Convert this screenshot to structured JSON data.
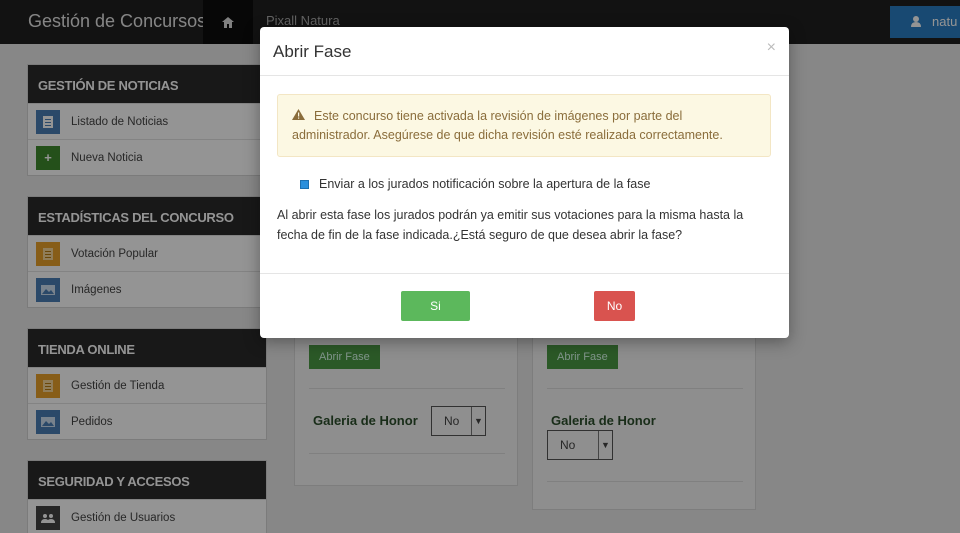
{
  "navbar": {
    "brand": "Gestión de Concursos",
    "home_icon": "home-icon",
    "link": "Pixall Natura",
    "user_label": "natu",
    "user_icon": "user-icon"
  },
  "sidebar": {
    "panels": [
      {
        "title": "GESTIÓN DE NOTICIAS",
        "items": [
          {
            "label": "Listado de Noticias",
            "icon": "document-icon"
          },
          {
            "label": "Nueva Noticia",
            "icon": "plus-icon"
          }
        ]
      },
      {
        "title": "ESTADÍSTICAS DEL CONCURSO",
        "items": [
          {
            "label": "Votación Popular",
            "icon": "list-icon"
          },
          {
            "label": "Imágenes",
            "icon": "image-icon"
          }
        ]
      },
      {
        "title": "TIENDA ONLINE",
        "items": [
          {
            "label": "Gestión de Tienda",
            "icon": "list-icon"
          },
          {
            "label": "Pedidos",
            "icon": "image-icon"
          }
        ]
      },
      {
        "title": "SEGURIDAD Y ACCESOS",
        "items": [
          {
            "label": "Gestión de Usuarios",
            "icon": "users-icon"
          }
        ]
      }
    ]
  },
  "cards": [
    {
      "open_phase_label": "Abrir Fase",
      "honor_label": "Galeria de Honor",
      "select_value": "No"
    },
    {
      "open_phase_label": "Abrir Fase",
      "honor_label": "Galeria de Honor",
      "select_value": "No"
    }
  ],
  "modal": {
    "title": "Abrir Fase",
    "close_label": "×",
    "alert_text": "Este concurso tiene activada la revisión de imágenes por parte del administrador. Asegúrese de que dicha revisión esté realizada correctamente.",
    "checkbox_label": "Enviar a los jurados notificación sobre la apertura de la fase",
    "checkbox_checked": true,
    "message": "Al abrir esta fase los jurados podrán ya emitir sus votaciones para la misma hasta la fecha de fin de la fase indicada.¿Está seguro de que desea abrir la fase?",
    "yes_label": "Si",
    "no_label": "No"
  },
  "colors": {
    "navbar": "#1f1f1f",
    "panel_header": "#2a2a2a",
    "alert_bg": "#fcf8e3",
    "yes_button": "#5cb85c",
    "no_button": "#d9534f",
    "user_button": "#2a7fc4"
  }
}
